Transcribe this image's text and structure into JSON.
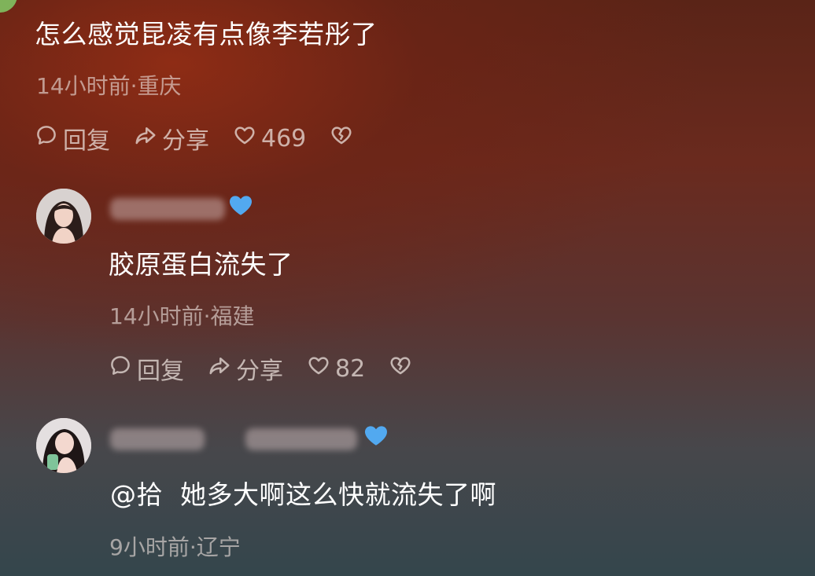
{
  "comments": [
    {
      "text": "怎么感觉昆凌有点像李若彤了",
      "meta": "14小时前·重庆",
      "reply_label": "回复",
      "share_label": "分享",
      "like_count": "469"
    },
    {
      "text": "胶原蛋白流失了",
      "meta": "14小时前·福建",
      "reply_label": "回复",
      "share_label": "分享",
      "like_count": "82"
    },
    {
      "text": "@拾  她多大啊这么快就流失了啊",
      "meta": "9小时前·辽宁"
    }
  ],
  "colors": {
    "badge": "#52a9f0",
    "text": "#ffffff",
    "muted_text": "#b7aaa5"
  },
  "icons": {
    "reply": "comment-bubble-icon",
    "share": "share-arrow-icon",
    "like": "heart-icon",
    "dislike": "broken-heart-icon",
    "verified": "blue-heart-icon"
  }
}
